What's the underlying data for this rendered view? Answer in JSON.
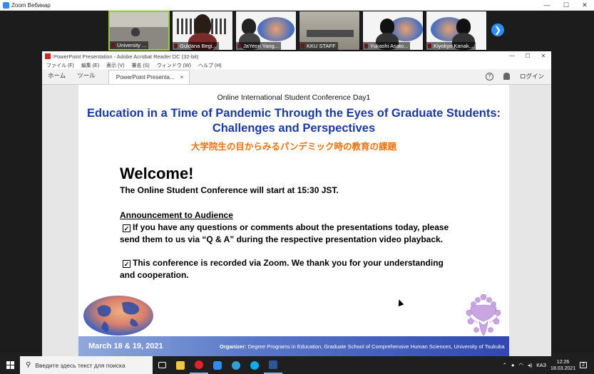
{
  "zoom": {
    "title": "Zoom Вебинар",
    "participants": [
      {
        "name": "University ..."
      },
      {
        "name": "Guldana Begi..."
      },
      {
        "name": "JaYeon Yang..."
      },
      {
        "name": "KKU STAFF"
      },
      {
        "name": "Yukashi Asato..."
      },
      {
        "name": "Kiyokyo Kanak..."
      }
    ],
    "next_glyph": "❯"
  },
  "acrobat": {
    "window_title": "PowerPoint Presentation - Adobe Acrobat Reader DC (32-bit)",
    "menu": [
      "ファイル (F)",
      "編集 (E)",
      "表示 (V)",
      "署名 (S)",
      "ウィンドウ (W)",
      "ヘルプ (H)"
    ],
    "home_tab": "ホーム",
    "tools_tab": "ツール",
    "doc_tab": "PowerPoint Presenta...",
    "doc_tab_close": "×",
    "help_glyph": "?",
    "login": "ログイン"
  },
  "slide": {
    "top_line": "Online International Student Conference Day1",
    "main_title_1": "Education in a Time of Pandemic Through the Eyes of Graduate Students:",
    "main_title_2": "Challenges and Perspectives",
    "jp_title": "大学院生の目からみるパンデミック時の教育の課題",
    "welcome": "Welcome!",
    "start_line": "The Online Student Conference will start at 15:30 JST.",
    "announce_heading": "Announcement to Audience",
    "check_glyph": "✓",
    "item1_a": "If you have any questions or comments about the presentations today, please",
    "item1_b": "send them to us via “Q & A” during the respective presentation video playback.",
    "item2_a": "This conference is recorded via Zoom. We thank you for your understanding",
    "item2_b": "and cooperation.",
    "dates": "March 18 & 19, 2021",
    "org_label": "Organizer:",
    "org_text": "Degree Programs in Education, Graduate School of Comprehensive Human Sciences, University of Tsukuba"
  },
  "taskbar": {
    "search_placeholder": "Введите здесь текст для поиска",
    "language": "КАЗ",
    "time": "12:26",
    "date": "18.03.2021",
    "notification_glyph": "2"
  },
  "colors": {
    "title_blue": "#1a3a9e",
    "jp_orange": "#e8720f",
    "footer_blue": "#3048b0",
    "zoom_blue": "#2d8cff"
  }
}
